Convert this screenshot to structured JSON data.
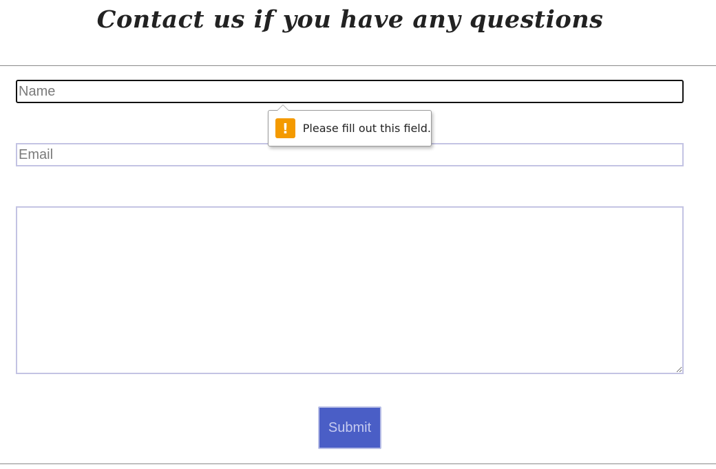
{
  "header": {
    "title": "Contact us if you have any questions"
  },
  "form": {
    "name_placeholder": "Name",
    "email_placeholder": "Email",
    "message_placeholder": "",
    "submit_label": "Submit"
  },
  "validation_tooltip": {
    "icon": "warning-icon",
    "icon_glyph": "!",
    "message": "Please fill out this field.",
    "icon_color": "#f49a00"
  },
  "colors": {
    "button_background": "#4a5ec6",
    "field_border": "#c3c3e3"
  }
}
